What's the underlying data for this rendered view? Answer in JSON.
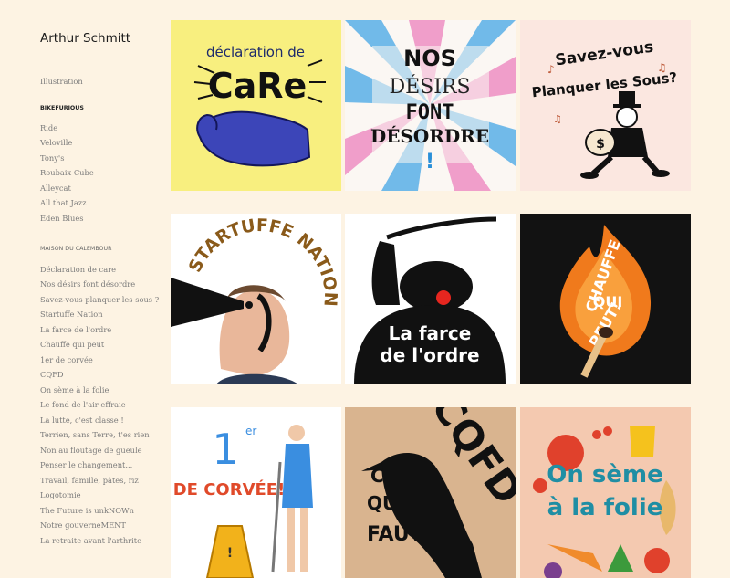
{
  "site": {
    "title": "Arthur Schmitt"
  },
  "nav": {
    "illustration": "Illustration",
    "bikefurious_heading": "BIKEFURIOUS",
    "bikefurious_items": [
      "Ride",
      "Veloville",
      "Tony's",
      "Roubaix Cube",
      "Alleycat",
      "All that Jazz",
      "Eden Blues"
    ],
    "calembour_heading": "MAISON DU CALEMBOUR",
    "calembour_items": [
      "Déclaration de care",
      "Nos désirs font désordre",
      "Savez-vous planquer les sous ?",
      "Startuffe Nation",
      "La farce de l'ordre",
      "Chauffe qui peut",
      "1er de corvée",
      "CQFD",
      "On sème à la folie",
      "Le fond de l'air effraie",
      "La lutte, c'est classe !",
      "Terrien, sans Terre, t'es rien",
      "Non au floutage de gueule",
      "Penser le changement...",
      "Travail, famille, pâtes, riz",
      "Logotomie",
      "The Future is unkNOWn",
      "Notre gouverneMENT",
      "La retraite avant l'arthrite"
    ]
  },
  "gallery": {
    "t1": {
      "l1": "déclaration de",
      "l2": "CaRe"
    },
    "t2": {
      "l1": "NOS",
      "l2": "DÉSIRS",
      "l3": "FONT",
      "l4": "DÉSORDRE"
    },
    "t3": {
      "l1": "Savez-vous",
      "l2": "Planquer les Sous?",
      "bag": "$"
    },
    "t4": {
      "l1": "STARTUFFE",
      "l2": "NATION"
    },
    "t5": {
      "l1": "La farce",
      "l2": "de l'ordre"
    },
    "t6": {
      "l1": "CHAUFFE",
      "l2": "QUI",
      "l3": "PEUT!"
    },
    "t7": {
      "l1": "1",
      "sup": "er",
      "l2": "DE CORVÉE!"
    },
    "t8": {
      "l1": "CQFD",
      "l2": "CE",
      "l3": "QU'IL",
      "l4": "FAUT"
    },
    "t9": {
      "l1": "On sème",
      "l2": "à la folie"
    }
  },
  "colors": {
    "background": "#fdf3e3",
    "t1_bg": "#f8ef7f",
    "t1_hand": "#3c45b8",
    "t4_arc": "#8a5a1a",
    "t6_flame": "#f07a1c",
    "t9_bg": "#f4c9b0",
    "t9_text": "#1f8ea4"
  }
}
